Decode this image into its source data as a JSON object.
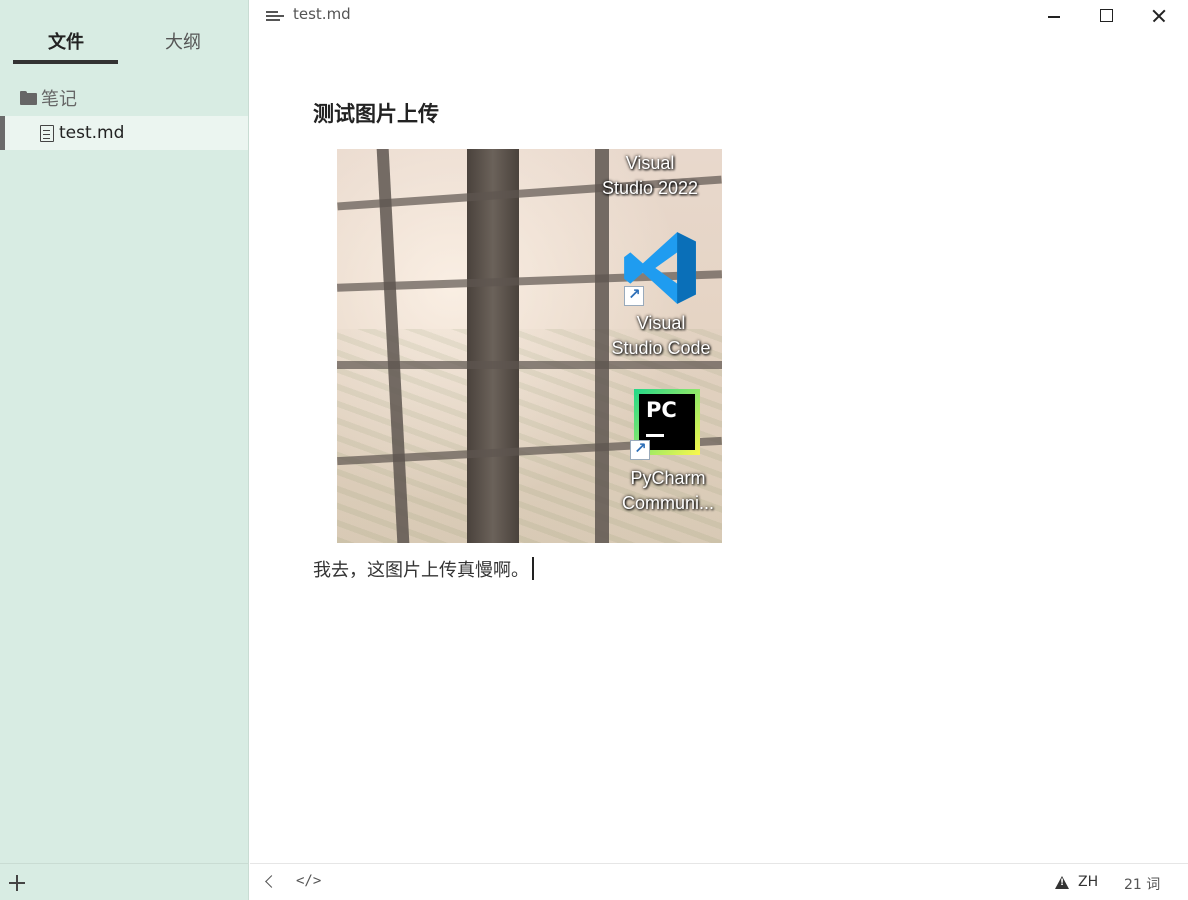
{
  "sidebar": {
    "tabs": [
      {
        "label": "文件",
        "active": true
      },
      {
        "label": "大纲",
        "active": false
      }
    ],
    "folder": {
      "label": "笔记",
      "icon": "folder-icon"
    },
    "files": [
      {
        "label": "test.md",
        "icon": "file-icon",
        "active": true
      }
    ],
    "add_icon": "plus-icon"
  },
  "titlebar": {
    "menu_icon": "menu-icon",
    "title": "test.md",
    "controls": [
      "minimize-icon",
      "maximize-icon",
      "close-icon"
    ]
  },
  "document": {
    "heading": "测试图片上传",
    "image": {
      "desktop_icons": [
        {
          "label_line1": "Visual",
          "label_line2": "Studio 2022"
        },
        {
          "label_line1": "Visual",
          "label_line2": "Studio Code",
          "icon": "vscode-icon"
        },
        {
          "label_line1": "PyCharm",
          "label_line2": "Communi...",
          "icon": "pycharm-icon",
          "icon_text": "PC"
        }
      ]
    },
    "paragraph": "我去，这图片上传真慢啊。"
  },
  "statusbar": {
    "back_icon": "chevron-left-icon",
    "source_code_label": "</>",
    "warning_icon": "warning-icon",
    "language": "ZH",
    "word_count": "21 词"
  },
  "colors": {
    "sidebar_bg": "#d8ece3",
    "active_file_bg": "#ebf5f0",
    "editor_bg": "#ffffff"
  }
}
